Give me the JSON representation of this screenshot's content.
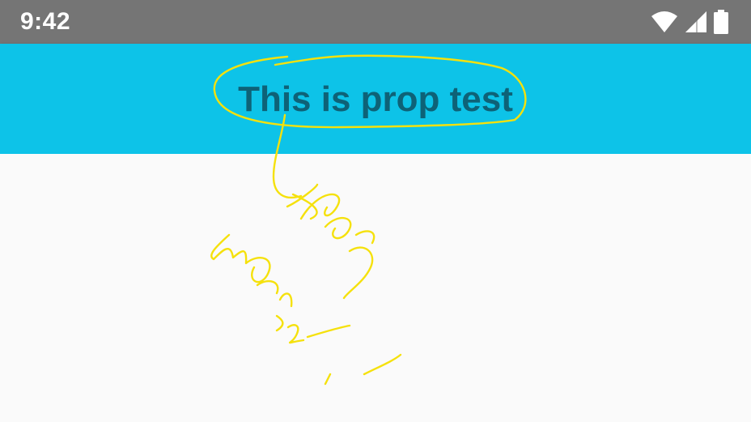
{
  "status_bar": {
    "time": "9:42",
    "icons": [
      "wifi-icon",
      "cell-signal-icon",
      "battery-icon"
    ]
  },
  "app_bar": {
    "title": "This is prop test",
    "background_color": "#0dc3e8",
    "title_color": "#0e6277"
  },
  "annotations": {
    "ink_color": "#f5e10c",
    "handwritten_text": "prop works!!"
  }
}
